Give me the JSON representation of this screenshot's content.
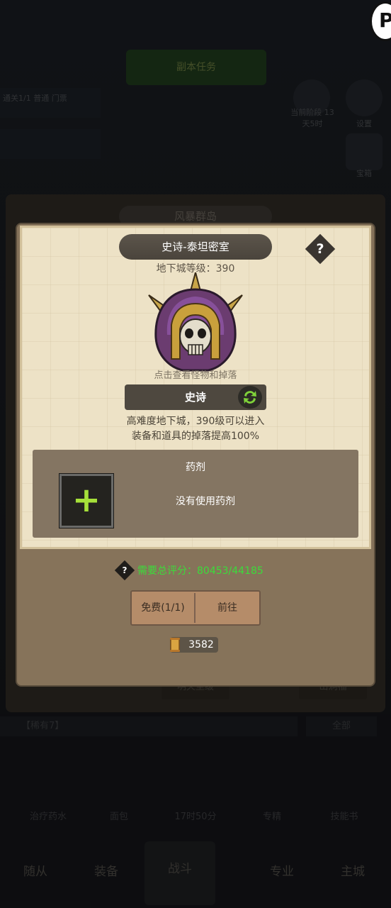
{
  "background": {
    "top_button": "副本任务",
    "left_row_1": "通关1/1 普通 门票",
    "right_gear_text": "当前阶段 13天5时",
    "right_settings": "设置",
    "right_chest": "宝箱",
    "panel_title": "风暴群岛",
    "panel_footer_left": "明天至级",
    "panel_footer_right": "山洞福",
    "search_box": "【稀有7】",
    "search_btn": "全部",
    "mid_items": [
      "治疗药水",
      "面包",
      "17时50分",
      "专精",
      "技能书"
    ],
    "tabs": [
      "随从",
      "装备",
      "战斗",
      "专业",
      "主城"
    ]
  },
  "dialog": {
    "title": "史诗-泰坦密室",
    "help": "?",
    "level": "地下城等级：390",
    "hint": "点击查看怪物和掉落",
    "difficulty": "史诗",
    "description_line1": "高难度地下城，390级可以进入",
    "description_line2": "装备和道具的掉落提高100%",
    "potion_title": "药剂",
    "potion_empty": "没有使用药剂",
    "potion_plus": "+",
    "requirement_q": "?",
    "requirement": "需要总评分：80453/44185",
    "free_button": "免费(1/1)",
    "go_button": "前往",
    "scroll_count": "3582"
  },
  "colors": {
    "accent_green": "#3bdc3a",
    "plus_green": "#a6e03a",
    "parchment": "#ede2c6",
    "frame": "#86735a"
  },
  "icons": [
    "help-icon",
    "refresh-icon",
    "plus-icon",
    "scroll-icon",
    "boss-helmet-icon"
  ]
}
